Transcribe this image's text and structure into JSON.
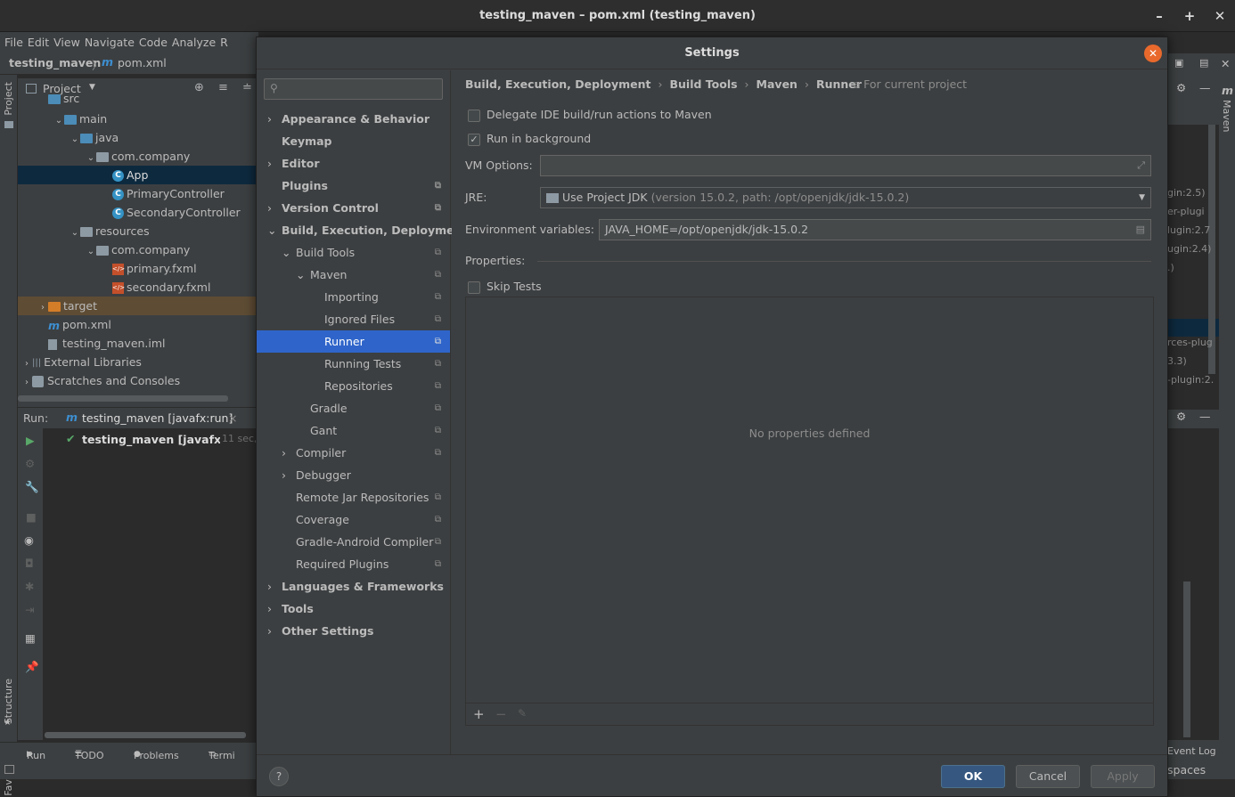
{
  "window": {
    "title": "testing_maven – pom.xml (testing_maven)"
  },
  "menu": [
    "File",
    "Edit",
    "View",
    "Navigate",
    "Code",
    "Analyze",
    "R"
  ],
  "nav": {
    "project": "testing_maven",
    "file": "pom.xml"
  },
  "side_tabs": {
    "project": "Project",
    "structure": "Structure",
    "favorites": "Favorites",
    "maven": "Maven"
  },
  "project_panel": {
    "title": "Project",
    "tree": [
      {
        "label": "src",
        "depth": 2,
        "icon": "folder-icon"
      },
      {
        "label": "main",
        "depth": 3,
        "icon": "folder-icon",
        "expanded": true
      },
      {
        "label": "java",
        "depth": 4,
        "icon": "folder-icon",
        "expanded": true
      },
      {
        "label": "com.company",
        "depth": 5,
        "icon": "package-icon",
        "expanded": true
      },
      {
        "label": "App",
        "depth": 6,
        "icon": "class-icon",
        "selected": true
      },
      {
        "label": "PrimaryController",
        "depth": 6,
        "icon": "class-icon"
      },
      {
        "label": "SecondaryController",
        "depth": 6,
        "icon": "class-icon"
      },
      {
        "label": "resources",
        "depth": 4,
        "icon": "folder-icon",
        "expanded": true
      },
      {
        "label": "com.company",
        "depth": 5,
        "icon": "package-icon",
        "expanded": true
      },
      {
        "label": "primary.fxml",
        "depth": 6,
        "icon": "fxml-icon"
      },
      {
        "label": "secondary.fxml",
        "depth": 6,
        "icon": "fxml-icon"
      },
      {
        "label": "target",
        "depth": 2,
        "icon": "folder-icon",
        "collapsed": true
      },
      {
        "label": "pom.xml",
        "depth": 2,
        "icon": "maven-icon"
      },
      {
        "label": "testing_maven.iml",
        "depth": 2,
        "icon": "file-icon"
      },
      {
        "label": "External Libraries",
        "depth": 1,
        "icon": "library-icon",
        "collapsed": true
      },
      {
        "label": "Scratches and Consoles",
        "depth": 1,
        "icon": "scratch-icon",
        "collapsed": true
      }
    ]
  },
  "run_panel": {
    "label": "Run:",
    "tab": "testing_maven [javafx:run]",
    "entry": "testing_maven [javafx:run",
    "time": "11 sec,"
  },
  "bottom_tabs": [
    "Run",
    "TODO",
    "Problems",
    "Termi"
  ],
  "right_panel": {
    "lines": [
      "gin:2.5)",
      "er-plugi",
      "lugin:2.7",
      "ugin:2.4)",
      ".)",
      "rces-plug",
      "3.3)",
      "-plugin:2."
    ],
    "event_log": "Event Log",
    "spaces": "spaces"
  },
  "dialog": {
    "title": "Settings",
    "search_placeholder": "",
    "nav": [
      {
        "label": "Appearance & Behavior",
        "level": 0,
        "bold": true,
        "arrow": "›"
      },
      {
        "label": "Keymap",
        "level": 0,
        "bold": true,
        "arrow": ""
      },
      {
        "label": "Editor",
        "level": 0,
        "bold": true,
        "arrow": "›"
      },
      {
        "label": "Plugins",
        "level": 0,
        "bold": true,
        "arrow": "",
        "copy": true
      },
      {
        "label": "Version Control",
        "level": 0,
        "bold": true,
        "arrow": "›",
        "copy": true
      },
      {
        "label": "Build, Execution, Deployment",
        "level": 0,
        "bold": true,
        "arrow": "⌄"
      },
      {
        "label": "Build Tools",
        "level": 1,
        "bold": false,
        "arrow": "⌄",
        "copy": true
      },
      {
        "label": "Maven",
        "level": 2,
        "bold": false,
        "arrow": "⌄",
        "copy": true
      },
      {
        "label": "Importing",
        "level": 3,
        "bold": false,
        "arrow": "",
        "copy": true
      },
      {
        "label": "Ignored Files",
        "level": 3,
        "bold": false,
        "arrow": "",
        "copy": true
      },
      {
        "label": "Runner",
        "level": 3,
        "bold": false,
        "arrow": "",
        "copy": true,
        "selected": true
      },
      {
        "label": "Running Tests",
        "level": 3,
        "bold": false,
        "arrow": "",
        "copy": true
      },
      {
        "label": "Repositories",
        "level": 3,
        "bold": false,
        "arrow": "",
        "copy": true
      },
      {
        "label": "Gradle",
        "level": 2,
        "bold": false,
        "arrow": "",
        "copy": true
      },
      {
        "label": "Gant",
        "level": 2,
        "bold": false,
        "arrow": "",
        "copy": true
      },
      {
        "label": "Compiler",
        "level": 1,
        "bold": false,
        "arrow": "›",
        "copy": true
      },
      {
        "label": "Debugger",
        "level": 1,
        "bold": false,
        "arrow": "›"
      },
      {
        "label": "Remote Jar Repositories",
        "level": 1,
        "bold": false,
        "arrow": "",
        "copy": true
      },
      {
        "label": "Coverage",
        "level": 1,
        "bold": false,
        "arrow": "",
        "copy": true
      },
      {
        "label": "Gradle-Android Compiler",
        "level": 1,
        "bold": false,
        "arrow": "",
        "copy": true
      },
      {
        "label": "Required Plugins",
        "level": 1,
        "bold": false,
        "arrow": "",
        "copy": true
      },
      {
        "label": "Languages & Frameworks",
        "level": 0,
        "bold": true,
        "arrow": "›"
      },
      {
        "label": "Tools",
        "level": 0,
        "bold": true,
        "arrow": "›"
      },
      {
        "label": "Other Settings",
        "level": 0,
        "bold": true,
        "arrow": "›"
      }
    ],
    "breadcrumb": [
      "Build, Execution, Deployment",
      "Build Tools",
      "Maven",
      "Runner"
    ],
    "scope": "For current project",
    "delegate_label": "Delegate IDE build/run actions to Maven",
    "delegate_checked": false,
    "background_label": "Run in background",
    "background_checked": true,
    "vm_label": "VM Options:",
    "vm_value": "",
    "jre_label": "JRE:",
    "jre_value": "Use Project JDK",
    "jre_detail": "(version 15.0.2, path: /opt/openjdk/jdk-15.0.2)",
    "env_label": "Environment variables:",
    "env_value": "JAVA_HOME=/opt/openjdk/jdk-15.0.2",
    "props_label": "Properties:",
    "skip_label": "Skip Tests",
    "skip_checked": false,
    "empty_text": "No properties defined",
    "buttons": {
      "ok": "OK",
      "cancel": "Cancel",
      "apply": "Apply",
      "help": "?"
    }
  }
}
